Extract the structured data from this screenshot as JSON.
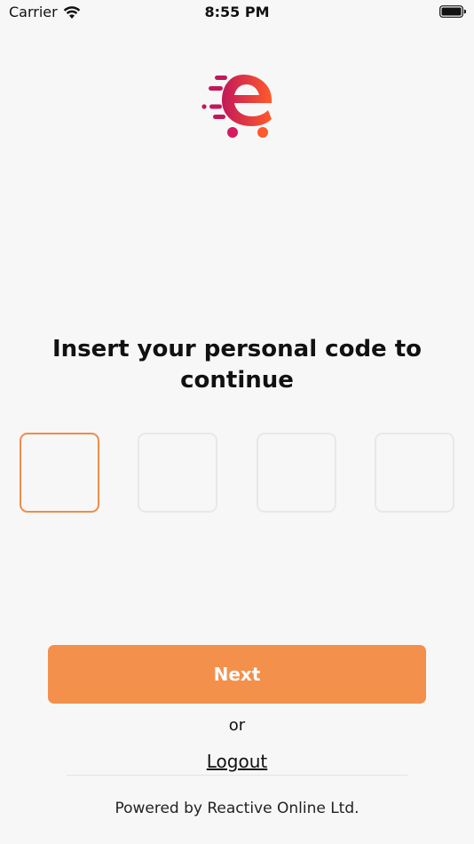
{
  "status_bar": {
    "carrier": "Carrier",
    "time": "8:55 PM"
  },
  "icons": {
    "wifi": "wifi-icon",
    "battery": "battery-icon",
    "logo": "cart-e-logo-icon"
  },
  "colors": {
    "accent": "#f2904c",
    "active_border": "#f08c4a",
    "inactive_border": "#e8e8e8",
    "background": "#f7f7f7",
    "logo_gradient_start": "#c2185b",
    "logo_gradient_end": "#ff5a2a"
  },
  "main": {
    "heading_line1": "Insert your personal code to",
    "heading_line2": "continue"
  },
  "actions": {
    "next_label": "Next",
    "or_label": "or",
    "logout_label": "Logout"
  },
  "footer": {
    "powered_by": "Powered by Reactive Online Ltd."
  }
}
